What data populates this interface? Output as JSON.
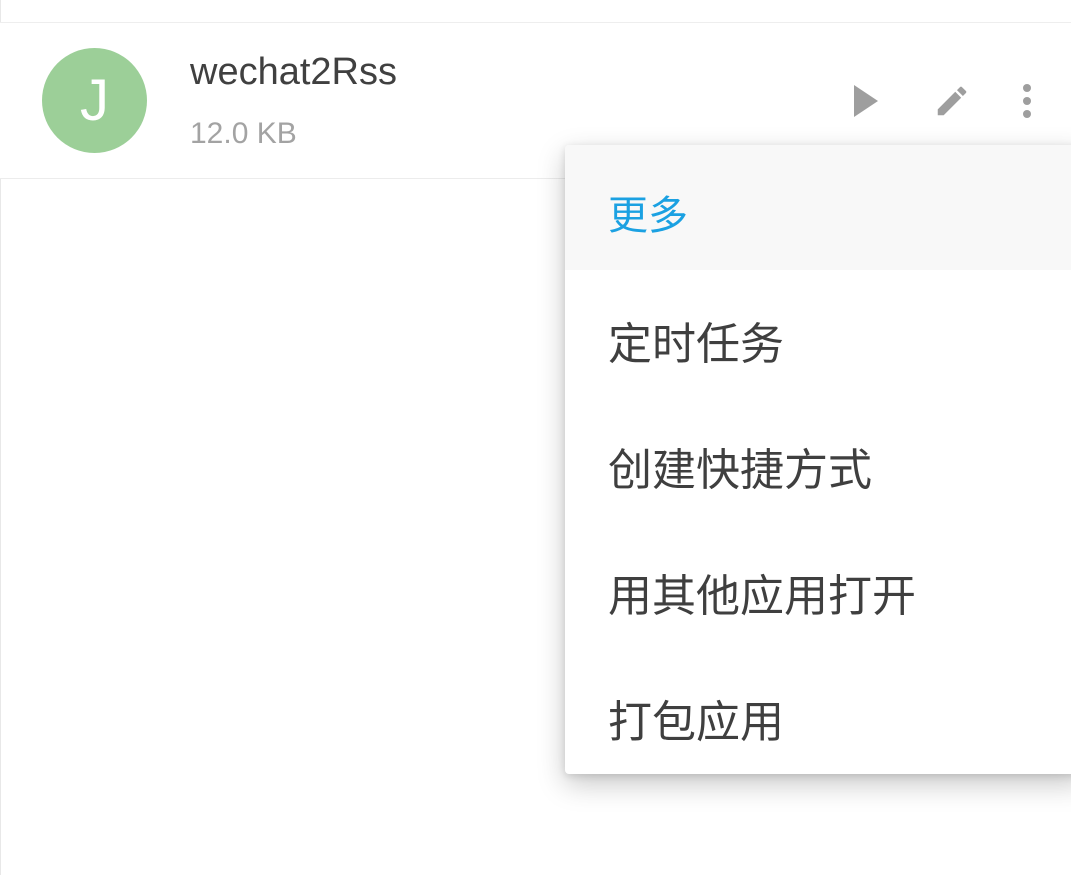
{
  "script": {
    "avatar_letter": "J",
    "name": "wechat2Rss",
    "size": "12.0 KB"
  },
  "actions": {
    "run": "play-icon",
    "edit": "pencil-icon",
    "more": "more-vert-icon"
  },
  "menu": {
    "title": "更多",
    "items": [
      {
        "label": "定时任务"
      },
      {
        "label": "创建快捷方式"
      },
      {
        "label": "用其他应用打开"
      },
      {
        "label": "打包应用"
      }
    ]
  },
  "colors": {
    "accent": "#1ba1e2",
    "avatar": "#9ccf98",
    "icon": "#9e9e9e"
  }
}
